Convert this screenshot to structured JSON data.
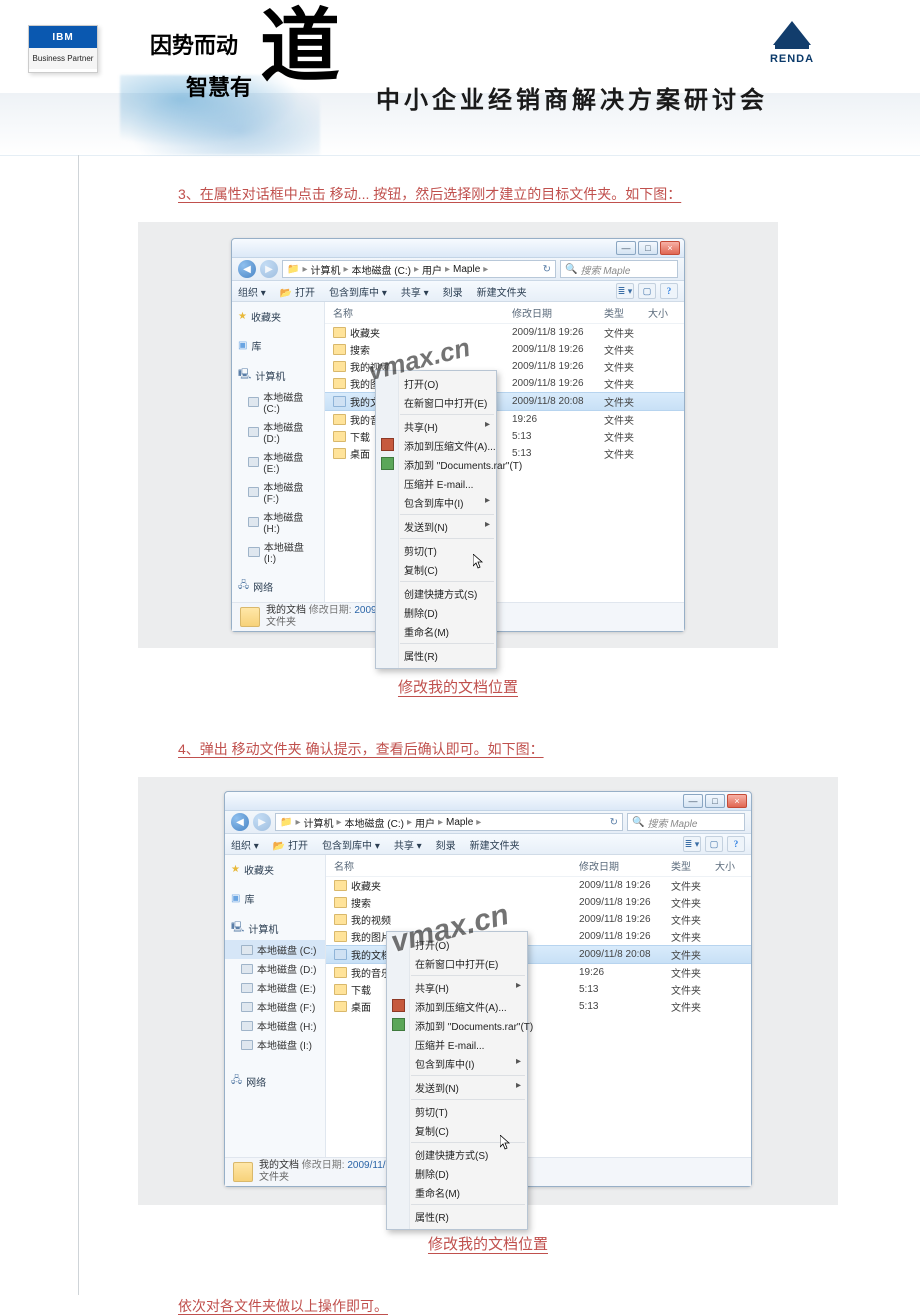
{
  "header": {
    "ibm_top": "IBM",
    "ibm_bot": "Business Partner",
    "slogan_line1": "因势而动",
    "slogan_line2": "智慧有",
    "dao": "道",
    "seminar": "中小企业经销商解决方案研讨会",
    "renda": "RENDA"
  },
  "step3": "3、在属性对话框中点击 移动... 按钮，然后选择刚才建立的目标文件夹。如下图：",
  "caption": "修改我的文档位置",
  "step4": "4、弹出 移动文件夹 确认提示，查看后确认即可。如下图：",
  "final": "依次对各文件夹做以上操作即可。",
  "watermark": "vmax.cn",
  "explorer": {
    "win_min": "—",
    "win_max": "□",
    "win_close": "×",
    "nav_back": "◀",
    "nav_fwd": "▶",
    "addr_icon": "📁",
    "breadcrumbs": [
      "计算机",
      "本地磁盘 (C:)",
      "用户",
      "Maple"
    ],
    "arrow": "▸",
    "refresh": "↻",
    "search_placeholder": "搜索 Maple",
    "search_icon": "🔍",
    "toolbar": {
      "org": "组织 ▾",
      "open": "📂 打开",
      "include": "包含到库中 ▾",
      "share": "共享 ▾",
      "burn": "刻录",
      "newfolder": "新建文件夹",
      "view": "≣ ▾",
      "preview": "▢",
      "help": "?"
    },
    "side": {
      "fav": "收藏夹",
      "lib": "库",
      "comp": "计算机",
      "drives": [
        "本地磁盘 (C:)",
        "本地磁盘 (D:)",
        "本地磁盘 (E:)",
        "本地磁盘 (F:)",
        "本地磁盘 (H:)",
        "本地磁盘 (I:)"
      ],
      "net": "网络",
      "fav_icon": "★",
      "lib_icon": "▣",
      "comp_icon": "🖳",
      "net_icon": "🖧"
    },
    "cols": {
      "name": "名称",
      "date": "修改日期",
      "type": "类型",
      "size": "大小"
    },
    "rows": [
      {
        "name": "收藏夹",
        "date": "2009/11/8 19:26",
        "type": "文件夹"
      },
      {
        "name": "搜索",
        "date": "2009/11/8 19:26",
        "type": "文件夹"
      },
      {
        "name": "我的视频",
        "date": "2009/11/8 19:26",
        "type": "文件夹"
      },
      {
        "name": "我的图片",
        "date": "2009/11/8 19:26",
        "type": "文件夹"
      },
      {
        "name": "我的文档",
        "date": "2009/11/8 20:08",
        "type": "文件夹",
        "sel": true
      },
      {
        "name": "我的音乐",
        "date": "19:26",
        "type": "文件夹",
        "partial": true
      },
      {
        "name": "下载",
        "date": "5:13",
        "type": "文件夹",
        "partial": true
      },
      {
        "name": "桌面",
        "date": "5:13",
        "type": "文件夹",
        "partial": true
      }
    ],
    "ctx": {
      "open": "打开(O)",
      "open_new": "在新窗口中打开(E)",
      "share": "共享(H)",
      "rar_add1": "添加到压缩文件(A)...",
      "rar_add2": "添加到 \"Documents.rar\"(T)",
      "rar_mail": "压缩并 E-mail...",
      "include": "包含到库中(I)",
      "sendto": "发送到(N)",
      "cut": "剪切(T)",
      "copy": "复制(C)",
      "shortcut": "创建快捷方式(S)",
      "delete": "删除(D)",
      "rename": "重命名(M)",
      "props": "属性(R)",
      "sub": "▸"
    },
    "status": {
      "title": "我的文档",
      "date_label": "修改日期:",
      "date": "2009/11/8 2",
      "type": "文件夹"
    }
  }
}
